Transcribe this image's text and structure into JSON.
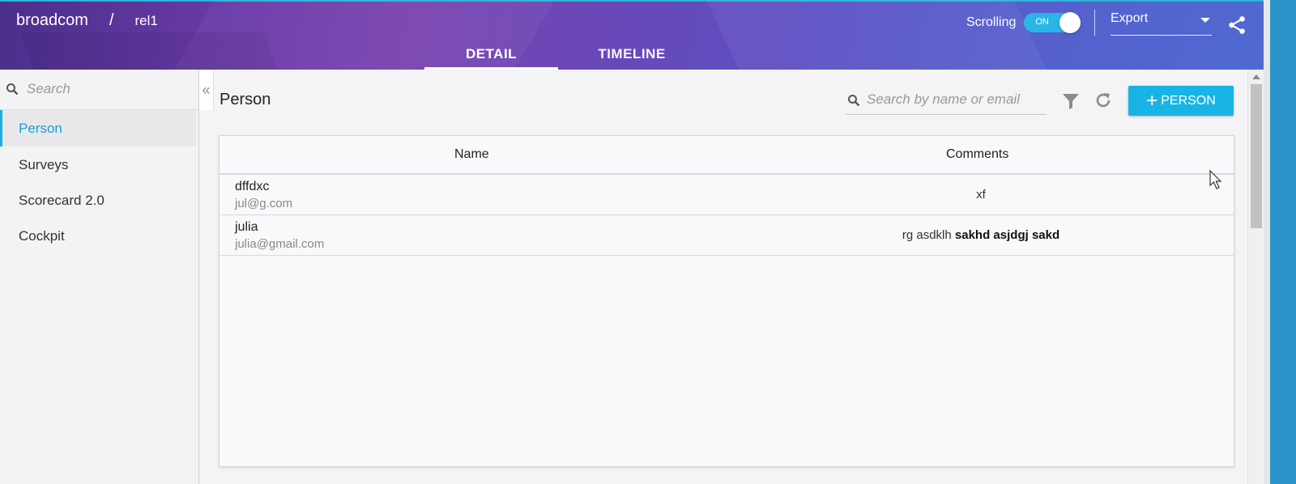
{
  "header": {
    "org": "broadcom",
    "separator": "/",
    "release": "rel1",
    "tabs": [
      {
        "label": "DETAIL",
        "active": true
      },
      {
        "label": "TIMELINE",
        "active": false
      }
    ],
    "scrolling_label": "Scrolling",
    "toggle_state": "ON",
    "export_label": "Export",
    "share_icon": "share-icon"
  },
  "sidebar": {
    "search_placeholder": "Search",
    "collapse_icon": "«",
    "items": [
      {
        "label": "Person",
        "active": true
      },
      {
        "label": "Surveys",
        "active": false
      },
      {
        "label": "Scorecard 2.0",
        "active": false
      },
      {
        "label": "Cockpit",
        "active": false
      }
    ]
  },
  "main": {
    "title": "Person",
    "search_placeholder": "Search by name or email",
    "add_button_plus": "+",
    "add_button_label": "PERSON",
    "table": {
      "columns": [
        "Name",
        "Comments"
      ],
      "rows": [
        {
          "name": "dffdxc",
          "email": "jul@g.com",
          "comment_plain": "xf",
          "comment_bold": ""
        },
        {
          "name": "julia",
          "email": "julia@gmail.com",
          "comment_plain": "rg asdklh ",
          "comment_bold": "sakhd asjdgj sakd"
        }
      ]
    }
  },
  "colors": {
    "accent": "#19b4e6",
    "header_start": "#4a2f8a",
    "header_end": "#4f6ad2"
  }
}
